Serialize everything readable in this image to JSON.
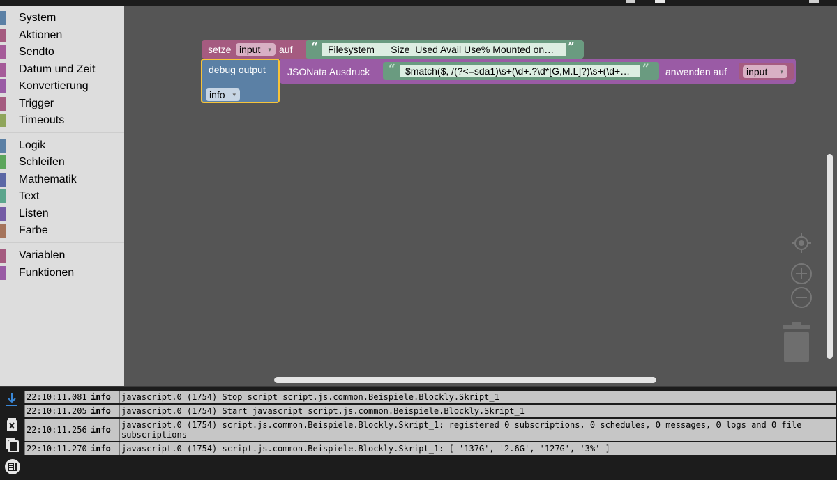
{
  "colors": {
    "workspace": "#555555",
    "toolbox": "#dddddd",
    "setze_block": "#a55b80",
    "debug_block": "#5b80a5",
    "jsonata_block": "#9a5ba5",
    "string_block": "#6a9b80",
    "highlight": "#f7c43a"
  },
  "toolbox": {
    "categories": [
      {
        "label": "System",
        "color": "#5b80a5"
      },
      {
        "label": "Aktionen",
        "color": "#a55b80"
      },
      {
        "label": "Sendto",
        "color": "#a55b99"
      },
      {
        "label": "Datum und Zeit",
        "color": "#a55b99"
      },
      {
        "label": "Konvertierung",
        "color": "#9a5ba5"
      },
      {
        "label": "Trigger",
        "color": "#a55b80"
      },
      {
        "label": "Timeouts",
        "color": "#8fa55b"
      },
      {
        "label": "Logik",
        "color": "#5b80a5"
      },
      {
        "label": "Schleifen",
        "color": "#5ba55b"
      },
      {
        "label": "Mathematik",
        "color": "#5b67a5"
      },
      {
        "label": "Text",
        "color": "#5ba58c"
      },
      {
        "label": "Listen",
        "color": "#745ba5"
      },
      {
        "label": "Farbe",
        "color": "#a5745b"
      },
      {
        "label": "Variablen",
        "color": "#a55b80"
      },
      {
        "label": "Funktionen",
        "color": "#995ba5"
      }
    ]
  },
  "blocks": {
    "setze": {
      "label": "setze",
      "variable": "input",
      "auf": "auf",
      "string_value": "Filesystem      Size  Used Avail Use% Mounted on…"
    },
    "debug": {
      "label": "debug output",
      "level": "info"
    },
    "jsonata": {
      "label": "JSONata Ausdruck",
      "expression": "$match($, /(?<=sda1)\\s+(\\d+.?\\d*[G,M.L]?)\\s+(\\d+…",
      "anwenden": "anwenden auf",
      "variable": "input"
    }
  },
  "icons": {
    "open_quote": "“",
    "close_quote": "”",
    "dropdown": "▾",
    "center": "target-icon",
    "zoom_in": "plus-icon",
    "zoom_out": "minus-icon",
    "trash": "trash-icon"
  },
  "log": {
    "entries": [
      {
        "time": "22:10:11.081",
        "severity": "info",
        "message": "javascript.0 (1754) Stop script script.js.common.Beispiele.Blockly.Skript_1"
      },
      {
        "time": "22:10:11.205",
        "severity": "info",
        "message": "javascript.0 (1754) Start javascript script.js.common.Beispiele.Blockly.Skript_1"
      },
      {
        "time": "22:10:11.256",
        "severity": "info",
        "message": "javascript.0 (1754) script.js.common.Beispiele.Blockly.Skript_1: registered 0 subscriptions, 0 schedules, 0 messages, 0 logs and 0 file subscriptions"
      },
      {
        "time": "22:10:11.270",
        "severity": "info",
        "message": "javascript.0 (1754) script.js.common.Beispiele.Blockly.Skript_1: [ '137G', '2.6G', '127G', '3%' ]"
      }
    ]
  }
}
